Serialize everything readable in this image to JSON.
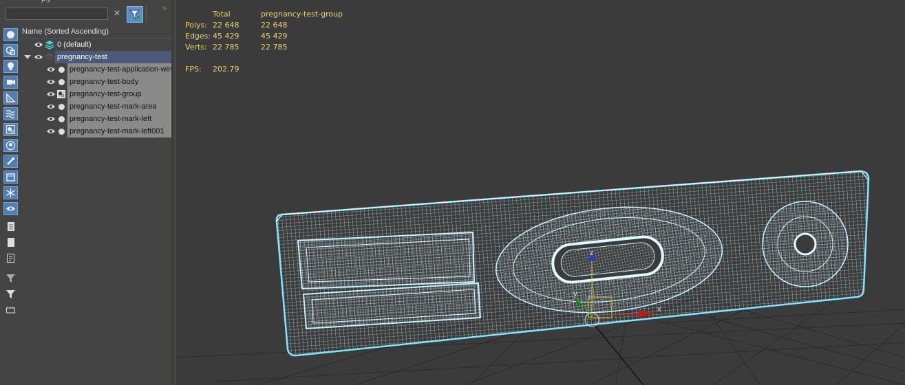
{
  "panel": {
    "title_partial": "ply",
    "search_placeholder": "",
    "clear_icon": "×",
    "collapse_icon": "»",
    "column_header": "Name (Sorted Ascending)"
  },
  "tree": {
    "default_layer": "0 (default)",
    "parent": "pregnancy-test",
    "children": [
      "pregnancy-test-application-window",
      "pregnancy-test-body",
      "pregnancy-test-group",
      "pregnancy-test-mark-area",
      "pregnancy-test-mark-left",
      "pregnancy-test-mark-left001"
    ]
  },
  "stats": {
    "header_total": "Total",
    "header_object": "pregnancy-test-group",
    "polys_label": "Polys:",
    "polys_total": "22 648",
    "polys_object": "22 648",
    "edges_label": "Edges:",
    "edges_total": "45 429",
    "edges_object": "45 429",
    "verts_label": "Verts:",
    "verts_total": "22 785",
    "verts_object": "22 785",
    "fps_label": "FPS:",
    "fps_value": "202.79"
  },
  "gizmo": {
    "x_label": "x",
    "y_label": "y",
    "z_label": "z"
  },
  "colors": {
    "accent": "#4f7fb1",
    "stats_text": "#e8d66a",
    "wire": "#bff0ff",
    "selection_highlight": "#8a8a8a"
  },
  "icons": [
    "search-icon",
    "clear-icon",
    "filter-icon",
    "sphere-icon",
    "shapes-icon",
    "light-icon",
    "camera-icon",
    "helper-icon",
    "spacewarp-icon",
    "group-icon",
    "xref-icon",
    "bone-icon",
    "container-icon",
    "frozen-icon",
    "hidden-icon",
    "eye-icon",
    "layer-icon"
  ]
}
